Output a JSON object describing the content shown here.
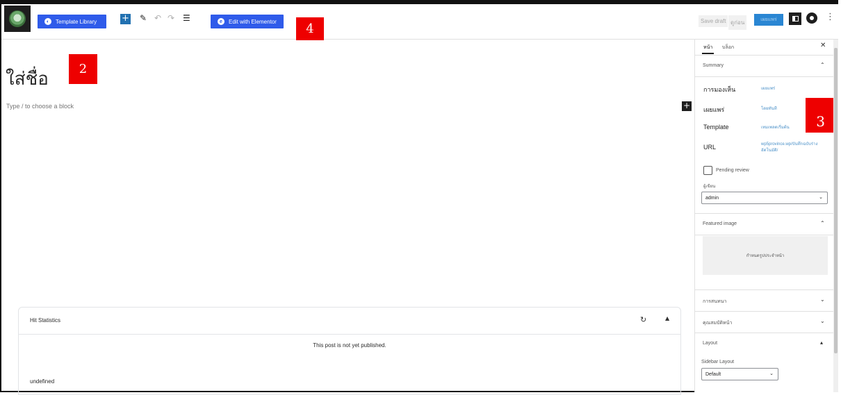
{
  "toolbar": {
    "template_library": "Template Library",
    "edit_elementor": "Edit with Elementor",
    "save_draft": "Save draft",
    "preview": "ดูก่อน",
    "publish": "เผยแพร่"
  },
  "badges": {
    "b2": "2",
    "b3": "3",
    "b4": "4"
  },
  "editor": {
    "title_placeholder": "ใส่ชื่อ",
    "block_placeholder": "Type / to choose a block"
  },
  "hit_statistics": {
    "title": "Hit Statistics",
    "message": "This post is not yet published.",
    "footer": "undefined"
  },
  "sidebar": {
    "tab_page": "หน้า",
    "tab_block": "บล็อก",
    "summary_label": "Summary",
    "rows": [
      {
        "label": "การมองเห็น",
        "value": "เผยแพร่"
      },
      {
        "label": "เผยแพร่",
        "value": "โดยทันที"
      },
      {
        "label": "Template",
        "value": "เทมเพลตเริ่มต้น"
      },
      {
        "label": "URL",
        "value": "wp5province.wp/บันทึกฉบับร่างอัตโนมัติ/"
      }
    ],
    "pending_review": "Pending review",
    "author_label": "ผู้เขียน",
    "author_value": "admin",
    "featured_image_label": "Featured image",
    "featured_image_button": "กำหนดรูปประจำหน้า",
    "discussion_label": "การสนทนา",
    "page_attributes_label": "คุณสมบัติหน้า",
    "layout_label": "Layout",
    "sidebar_layout_label": "Sidebar Layout",
    "sidebar_layout_value": "Default"
  }
}
